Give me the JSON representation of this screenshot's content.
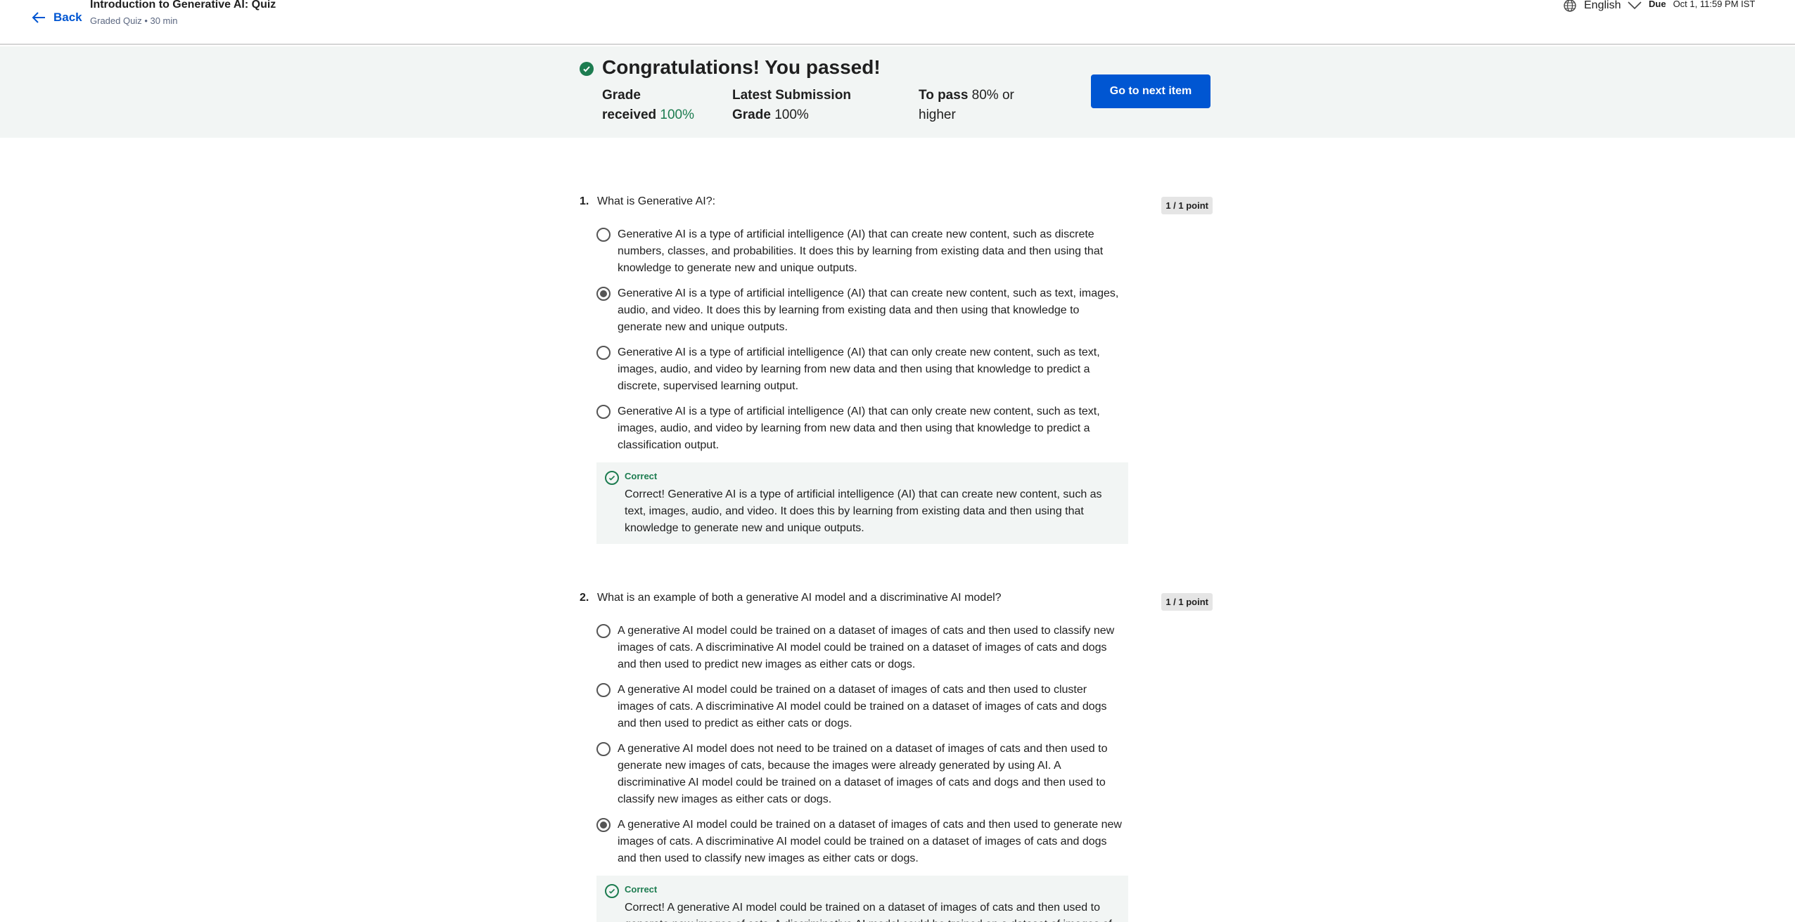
{
  "header": {
    "back_label": "Back",
    "course_title": "Introduction to Generative AI: Quiz",
    "course_sub": "Graded Quiz • 30 min",
    "language": "English",
    "due_label": "Due",
    "due_value": "Oct 1, 11:59 PM IST"
  },
  "banner": {
    "title": "Congratulations! You passed!",
    "grade_label_1": "Grade",
    "grade_label_2": "received",
    "grade_value": "100%",
    "latest_label_1": "Latest Submission",
    "latest_label_2": "Grade",
    "latest_value": "100%",
    "pass_label": "To pass",
    "pass_value_1": "80% or",
    "pass_value_2": "higher",
    "next_button": "Go to next item"
  },
  "questions": [
    {
      "number": "1.",
      "text": "What is Generative AI?:",
      "points": "1 / 1 point",
      "options": [
        {
          "text": "Generative AI is a type of artificial intelligence (AI) that can create new content, such as discrete numbers, classes, and probabilities. It does this by learning from existing data and then using that knowledge to generate new and unique outputs.",
          "selected": false
        },
        {
          "text": "Generative AI is a type of artificial intelligence (AI) that can create new content, such as text, images, audio, and video. It does this by learning from existing data and then using that knowledge to generate new and unique outputs.",
          "selected": true
        },
        {
          "text": "Generative AI is a type of artificial intelligence (AI) that can only create new content, such as text, images, audio, and video by learning from new data and then using that knowledge to predict a discrete, supervised learning output.",
          "selected": false
        },
        {
          "text": "Generative AI is a type of artificial intelligence (AI) that can only create new content, such as text, images, audio, and video by learning from new data and then using that knowledge to predict a classification output.",
          "selected": false
        }
      ],
      "feedback_label": "Correct",
      "feedback_text": "Correct! Generative AI is a type of artificial intelligence (AI) that can create new content, such as text, images, audio, and video. It does this by learning from existing data and then using that knowledge to generate new and unique outputs."
    },
    {
      "number": "2.",
      "text": "What is an example of both a generative AI model and a discriminative AI model?",
      "points": "1 / 1 point",
      "options": [
        {
          "text": "A generative AI model could be trained on a dataset of images of cats and then used to classify new images of cats. A discriminative AI model could be trained on a dataset of images of cats and dogs and then used to predict new images as either cats or dogs.",
          "selected": false
        },
        {
          "text": "A generative AI model could be trained on a dataset of images of cats and then used to cluster images of cats. A discriminative AI model could be trained on a dataset of images of cats and dogs and then used to predict as either cats or dogs.",
          "selected": false
        },
        {
          "text": "A generative AI model does not need to be trained on a dataset of images of cats and then used to generate new images of cats, because the images were already generated by using AI. A discriminative AI model could be trained on a dataset of images of cats and dogs and then used to classify new images as either cats or dogs.",
          "selected": false
        },
        {
          "text": "A generative AI model could be trained on a dataset of images of cats and then used to generate new images of cats. A discriminative AI model could be trained on a dataset of images of cats and dogs and then used to classify new images as either cats or dogs.",
          "selected": true
        }
      ],
      "feedback_label": "Correct",
      "feedback_text": "Correct! A generative AI model could be trained on a dataset of images of cats and then used to generate new images of cats. A discriminative AI model could be trained on a dataset of images of cats and dogs"
    }
  ],
  "colors": {
    "accent": "#0056d2",
    "success": "#1d7c50",
    "banner_bg": "#f2f5f4"
  }
}
